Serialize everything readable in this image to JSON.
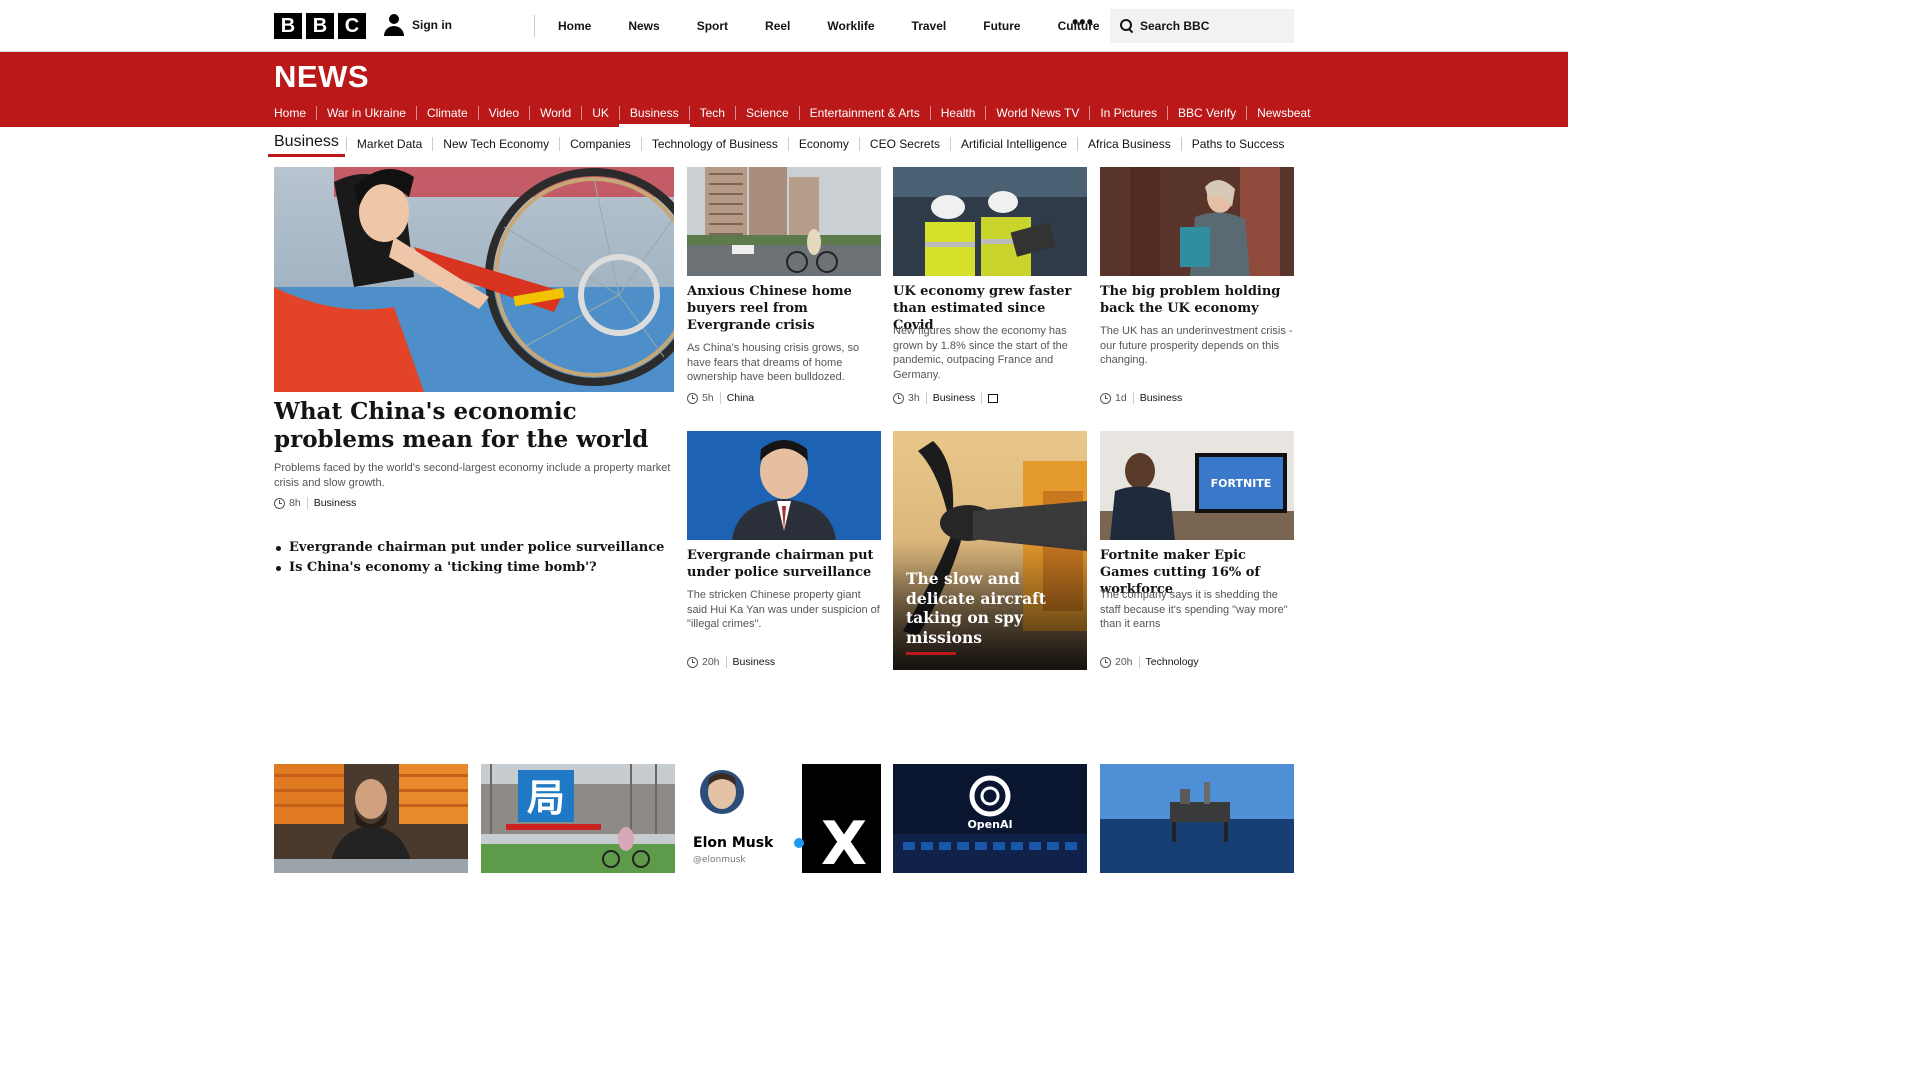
{
  "topbar": {
    "logo_letters": [
      "B",
      "B",
      "C"
    ],
    "signin_label": "Sign in",
    "nav": [
      "Home",
      "News",
      "Sport",
      "Reel",
      "Worklife",
      "Travel",
      "Future",
      "Culture"
    ],
    "more_label": "•••",
    "search_placeholder": "Search BBC"
  },
  "newsbar": {
    "logo": "NEWS",
    "nav": [
      "Home",
      "War in Ukraine",
      "Climate",
      "Video",
      "World",
      "UK",
      "Business",
      "Tech",
      "Science",
      "Entertainment & Arts",
      "Health",
      "World News TV",
      "In Pictures",
      "BBC Verify",
      "Newsbeat"
    ],
    "active": "Business"
  },
  "subnav": {
    "title": "Business",
    "items": [
      "Market Data",
      "New Tech Economy",
      "Companies",
      "Technology of Business",
      "Economy",
      "CEO Secrets",
      "Artificial Intelligence",
      "Africa Business",
      "Paths to Success"
    ]
  },
  "lead": {
    "headline": "What China's economic problems mean for the world",
    "summary": "Problems faced by the world's second-largest economy include a property market crisis and slow growth.",
    "time": "8h",
    "tag": "Business",
    "related": [
      "Evergrande chairman put under police surveillance",
      "Is China's economy a 'ticking time bomb'?"
    ]
  },
  "cards": [
    {
      "headline": "Anxious Chinese home buyers reel from Evergrande crisis",
      "summary": "As China's housing crisis grows, so have fears that dreams of home ownership have been bulldozed.",
      "time": "5h",
      "tag": "China"
    },
    {
      "headline": "UK economy grew faster than estimated since Covid",
      "summary": "New figures show the economy has grown by 1.8% since the start of the pandemic, outpacing France and Germany.",
      "time": "3h",
      "tag": "Business"
    },
    {
      "headline": "The big problem holding back the UK economy",
      "summary": "The UK has an underinvestment crisis - our future prosperity depends on this changing.",
      "time": "1d",
      "tag": "Business"
    },
    {
      "headline": "Evergrande chairman put under police surveillance",
      "summary": "The stricken Chinese property giant said Hui Ka Yan was under suspicion of \"illegal crimes\".",
      "time": "20h",
      "tag": "Business"
    },
    {
      "headline": "The slow and delicate aircraft taking on spy missions"
    },
    {
      "headline": "Fortnite maker Epic Games cutting 16% of workforce",
      "summary": "The company says it is shedding the staff because it's spending \"way more\" than it earns",
      "time": "20h",
      "tag": "Technology"
    }
  ],
  "image_text": {
    "fortnite": "FORTNITE",
    "building_sign": "局",
    "musk_name": "Elon Musk",
    "musk_handle": "@elonmusk",
    "x_logo": "X",
    "openai": "OpenAI"
  },
  "colors": {
    "brand_red": "#bb1919"
  }
}
